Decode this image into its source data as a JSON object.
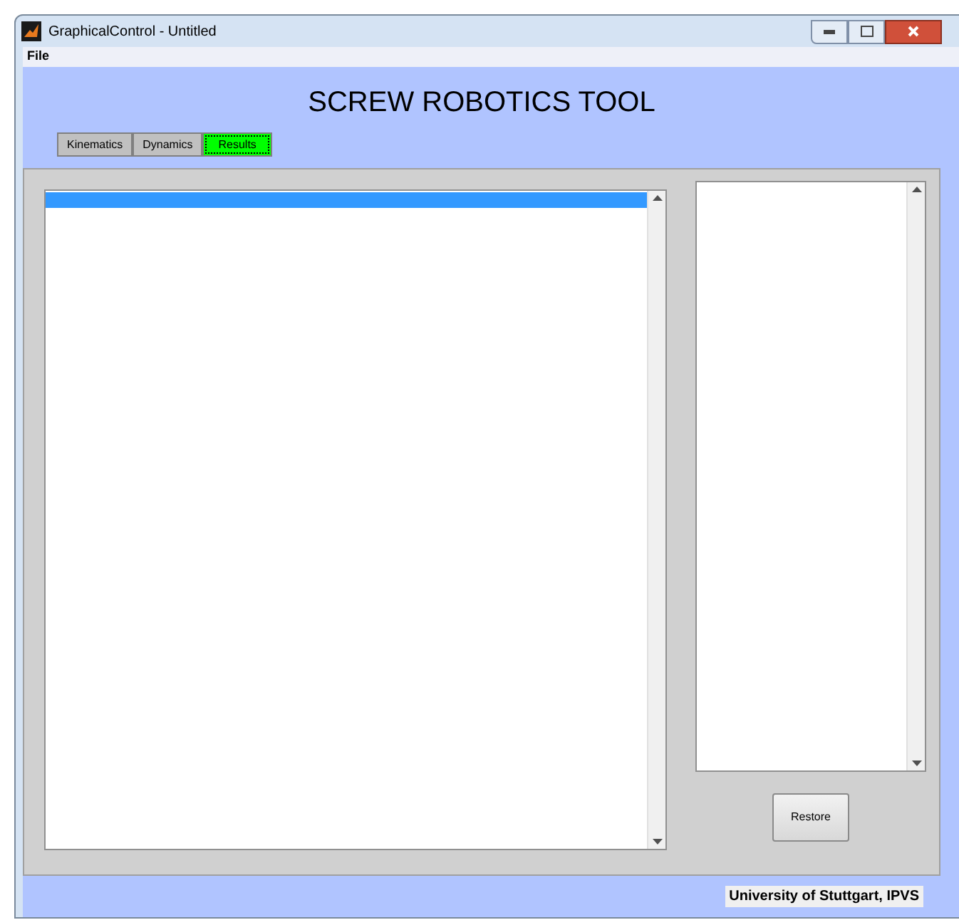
{
  "window": {
    "title": "GraphicalControl - Untitled"
  },
  "menu": [
    "File"
  ],
  "heading": "SCREW ROBOTICS TOOL",
  "tabs": [
    {
      "label": "Kinematics",
      "selected": false
    },
    {
      "label": "Dynamics",
      "selected": false
    },
    {
      "label": "Results",
      "selected": true
    }
  ],
  "results_list": {
    "items": [
      {
        "selected": true
      }
    ]
  },
  "restore_button": "Restore",
  "footer": "University of Stuttgart, IPVS"
}
